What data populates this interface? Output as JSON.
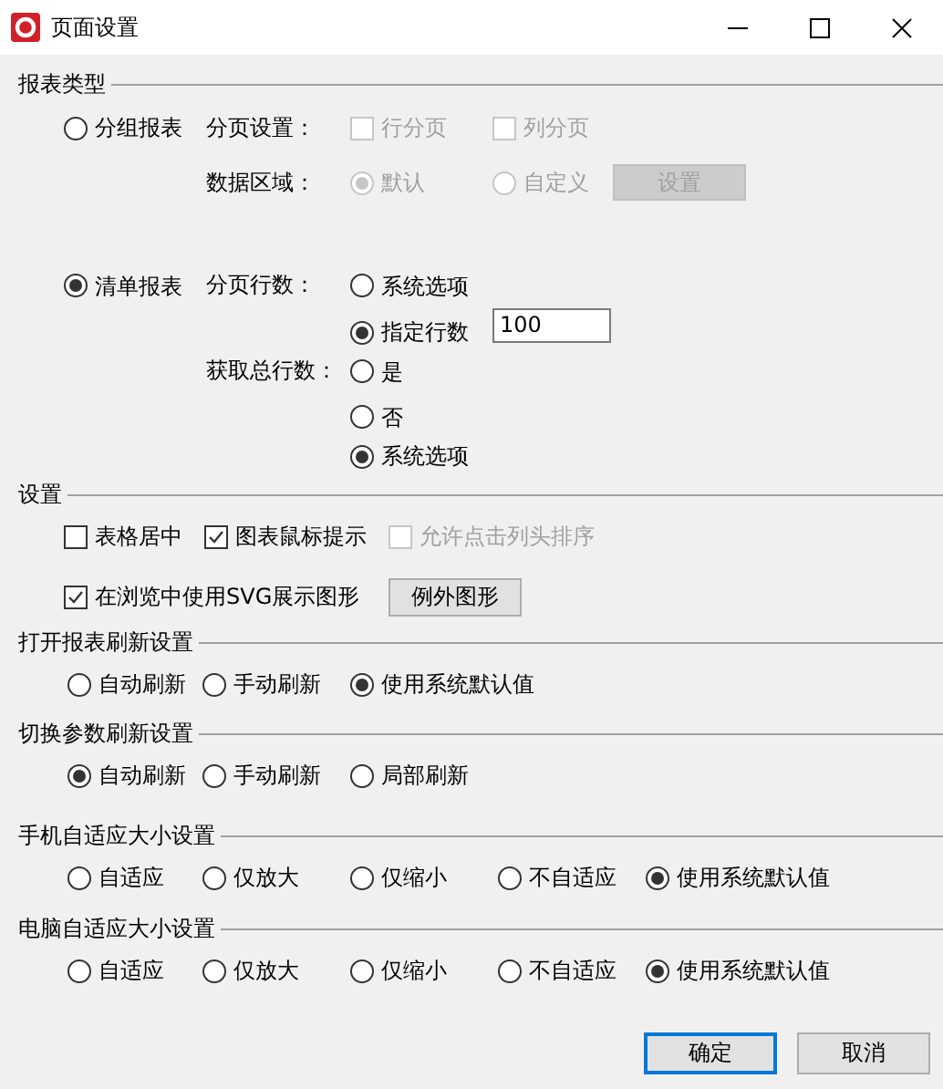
{
  "window": {
    "title": "页面设置"
  },
  "report_type": {
    "label": "报表类型",
    "grouped": {
      "label": "分组报表",
      "selected": false,
      "paging": {
        "label": "分页设置：",
        "options": [
          {
            "label": "行分页",
            "checked": false,
            "disabled": true
          },
          {
            "label": "列分页",
            "checked": false,
            "disabled": true
          }
        ]
      },
      "data_area": {
        "label": "数据区域：",
        "options": [
          {
            "label": "默认",
            "selected": true,
            "disabled": true
          },
          {
            "label": "自定义",
            "selected": false,
            "disabled": true
          }
        ],
        "button": {
          "label": "设置",
          "disabled": true
        }
      }
    },
    "list": {
      "label": "清单报表",
      "selected": true,
      "rows_per_page": {
        "label": "分页行数：",
        "options": [
          {
            "label": "系统选项",
            "selected": false
          },
          {
            "label": "指定行数",
            "selected": true
          }
        ],
        "value": "100"
      },
      "total_rows": {
        "label": "获取总行数：",
        "options": [
          {
            "label": "是",
            "selected": false
          },
          {
            "label": "否",
            "selected": false
          },
          {
            "label": "系统选项",
            "selected": true
          }
        ]
      }
    }
  },
  "settings": {
    "label": "设置",
    "checks": [
      {
        "label": "表格居中",
        "checked": false,
        "disabled": false
      },
      {
        "label": "图表鼠标提示",
        "checked": true,
        "disabled": false
      },
      {
        "label": "允许点击列头排序",
        "checked": false,
        "disabled": true
      }
    ],
    "svg": {
      "label": "在浏览中使用SVG展示图形",
      "checked": true
    },
    "button": {
      "label": "例外图形"
    }
  },
  "radio_groups": [
    {
      "label": "打开报表刷新设置",
      "options": [
        {
          "label": "自动刷新",
          "selected": false
        },
        {
          "label": "手动刷新",
          "selected": false
        },
        {
          "label": "使用系统默认值",
          "selected": true
        }
      ]
    },
    {
      "label": "切换参数刷新设置",
      "options": [
        {
          "label": "自动刷新",
          "selected": true
        },
        {
          "label": "手动刷新",
          "selected": false
        },
        {
          "label": "局部刷新",
          "selected": false
        }
      ]
    },
    {
      "label": "手机自适应大小设置",
      "options": [
        {
          "label": "自适应",
          "selected": false
        },
        {
          "label": "仅放大",
          "selected": false
        },
        {
          "label": "仅缩小",
          "selected": false
        },
        {
          "label": "不自适应",
          "selected": false
        },
        {
          "label": "使用系统默认值",
          "selected": true
        }
      ]
    },
    {
      "label": "电脑自适应大小设置",
      "options": [
        {
          "label": "自适应",
          "selected": false
        },
        {
          "label": "仅放大",
          "selected": false
        },
        {
          "label": "仅缩小",
          "selected": false
        },
        {
          "label": "不自适应",
          "selected": false
        },
        {
          "label": "使用系统默认值",
          "selected": true
        }
      ]
    }
  ],
  "buttons": [
    {
      "label": "确定",
      "default": true
    },
    {
      "label": "取消",
      "default": false
    }
  ]
}
